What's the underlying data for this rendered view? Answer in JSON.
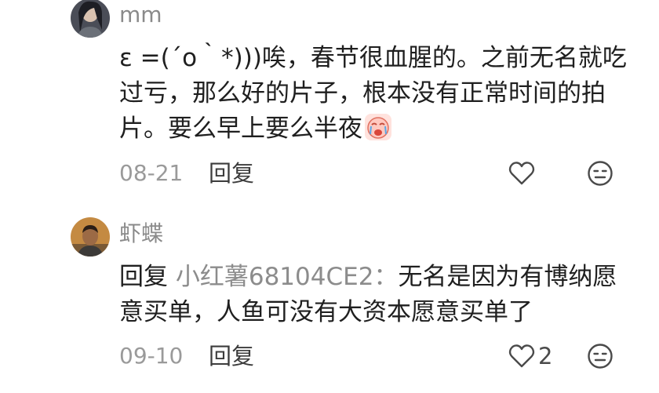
{
  "comments": [
    {
      "username": "mm",
      "text": "ε =(´ο｀*)))唉，春节很血腥的。之前无名就吃过亏，那么好的片子，根本没有正常时间的拍片。要么早上要么半夜",
      "emoji_icon": "crying-face-emoji",
      "date": "08-21",
      "reply_label": "回复",
      "like_count": "",
      "avatar_icon": "user-avatar-dark-hair"
    },
    {
      "username": "虾蝶",
      "reply_prefix": "回复",
      "reply_target": "小红薯68104CE2：",
      "text": "无名是因为有博纳愿意买单，人鱼可没有大资本愿意买单了",
      "date": "09-10",
      "reply_label": "回复",
      "like_count": "2",
      "avatar_icon": "user-avatar-man-photo"
    }
  ],
  "icons": {
    "like": "heart-outline-icon",
    "dislike": "neutral-face-icon"
  },
  "colors": {
    "text": "#1f1f1f",
    "muted": "#8a8a8a",
    "icon_stroke": "#4a4a4a"
  }
}
